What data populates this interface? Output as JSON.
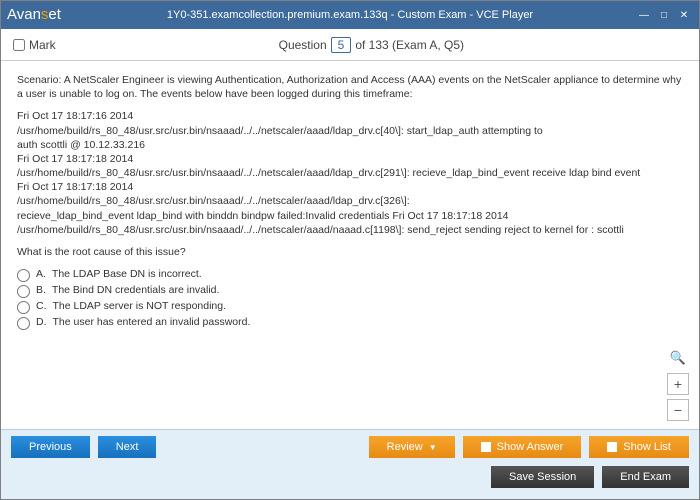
{
  "window": {
    "title": "1Y0-351.examcollection.premium.exam.133q - Custom Exam - VCE Player",
    "logo_l": "Avan",
    "logo_m": "s",
    "logo_r": "et"
  },
  "header": {
    "mark_label": "Mark",
    "question_label": "Question",
    "number": "5",
    "total_text": "of 133 (Exam A, Q5)"
  },
  "scenario": "Scenario: A NetScaler Engineer is viewing Authentication, Authorization and Access (AAA) events on the NetScaler appliance to determine why a user is unable to log on. The events below have been logged during this timeframe:",
  "log1": "Fri Oct 17 18:17:16 2014\n/usr/home/build/rs_80_48/usr.src/usr.bin/nsaaad/../../netscaler/aaad/ldap_drv.c[40\\]: start_ldap_auth attempting to\nauth scottli @ 10.12.33.216\nFri Oct 17 18:17:18 2014\n/usr/home/build/rs_80_48/usr.src/usr.bin/nsaaad/../../netscaler/aaad/ldap_drv.c[291\\]: recieve_ldap_bind_event receive ldap bind event\nFri Oct 17 18:17:18 2014\n/usr/home/build/rs_80_48/usr.src/usr.bin/nsaaad/../../netscaler/aaad/ldap_drv.c[326\\]:\nrecieve_ldap_bind_event ldap_bind with binddn bindpw failed:Invalid credentials Fri Oct 17 18:17:18 2014 /usr/home/build/rs_80_48/usr.src/usr.bin/nsaaad/../../netscaler/aaad/naaad.c[1198\\]: send_reject sending reject to kernel for : scottli",
  "question": "What is the root cause of this issue?",
  "options": [
    {
      "letter": "A.",
      "text": "The LDAP Base DN is incorrect."
    },
    {
      "letter": "B.",
      "text": "The Bind DN credentials are invalid."
    },
    {
      "letter": "C.",
      "text": "The LDAP server is NOT responding."
    },
    {
      "letter": "D.",
      "text": "The user has entered an invalid password."
    }
  ],
  "footer": {
    "previous": "Previous",
    "next": "Next",
    "review": "Review",
    "show_answer": "Show Answer",
    "show_list": "Show List",
    "save_session": "Save Session",
    "end_exam": "End Exam"
  }
}
